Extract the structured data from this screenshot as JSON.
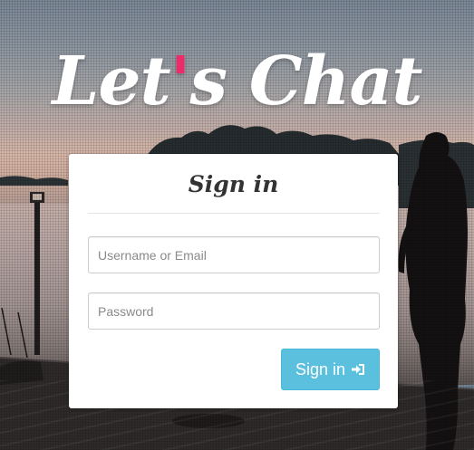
{
  "logo": {
    "text_before": "Let",
    "apostrophe": "'",
    "text_after": "s Chat",
    "apostrophe_color": "#ee2a6b"
  },
  "login": {
    "title": "Sign in",
    "username": {
      "value": "",
      "placeholder": "Username or Email"
    },
    "password": {
      "value": "",
      "placeholder": "Password"
    },
    "submit_label": "Sign in",
    "submit_icon": "sign-in-icon",
    "button_color": "#5bc0de"
  }
}
